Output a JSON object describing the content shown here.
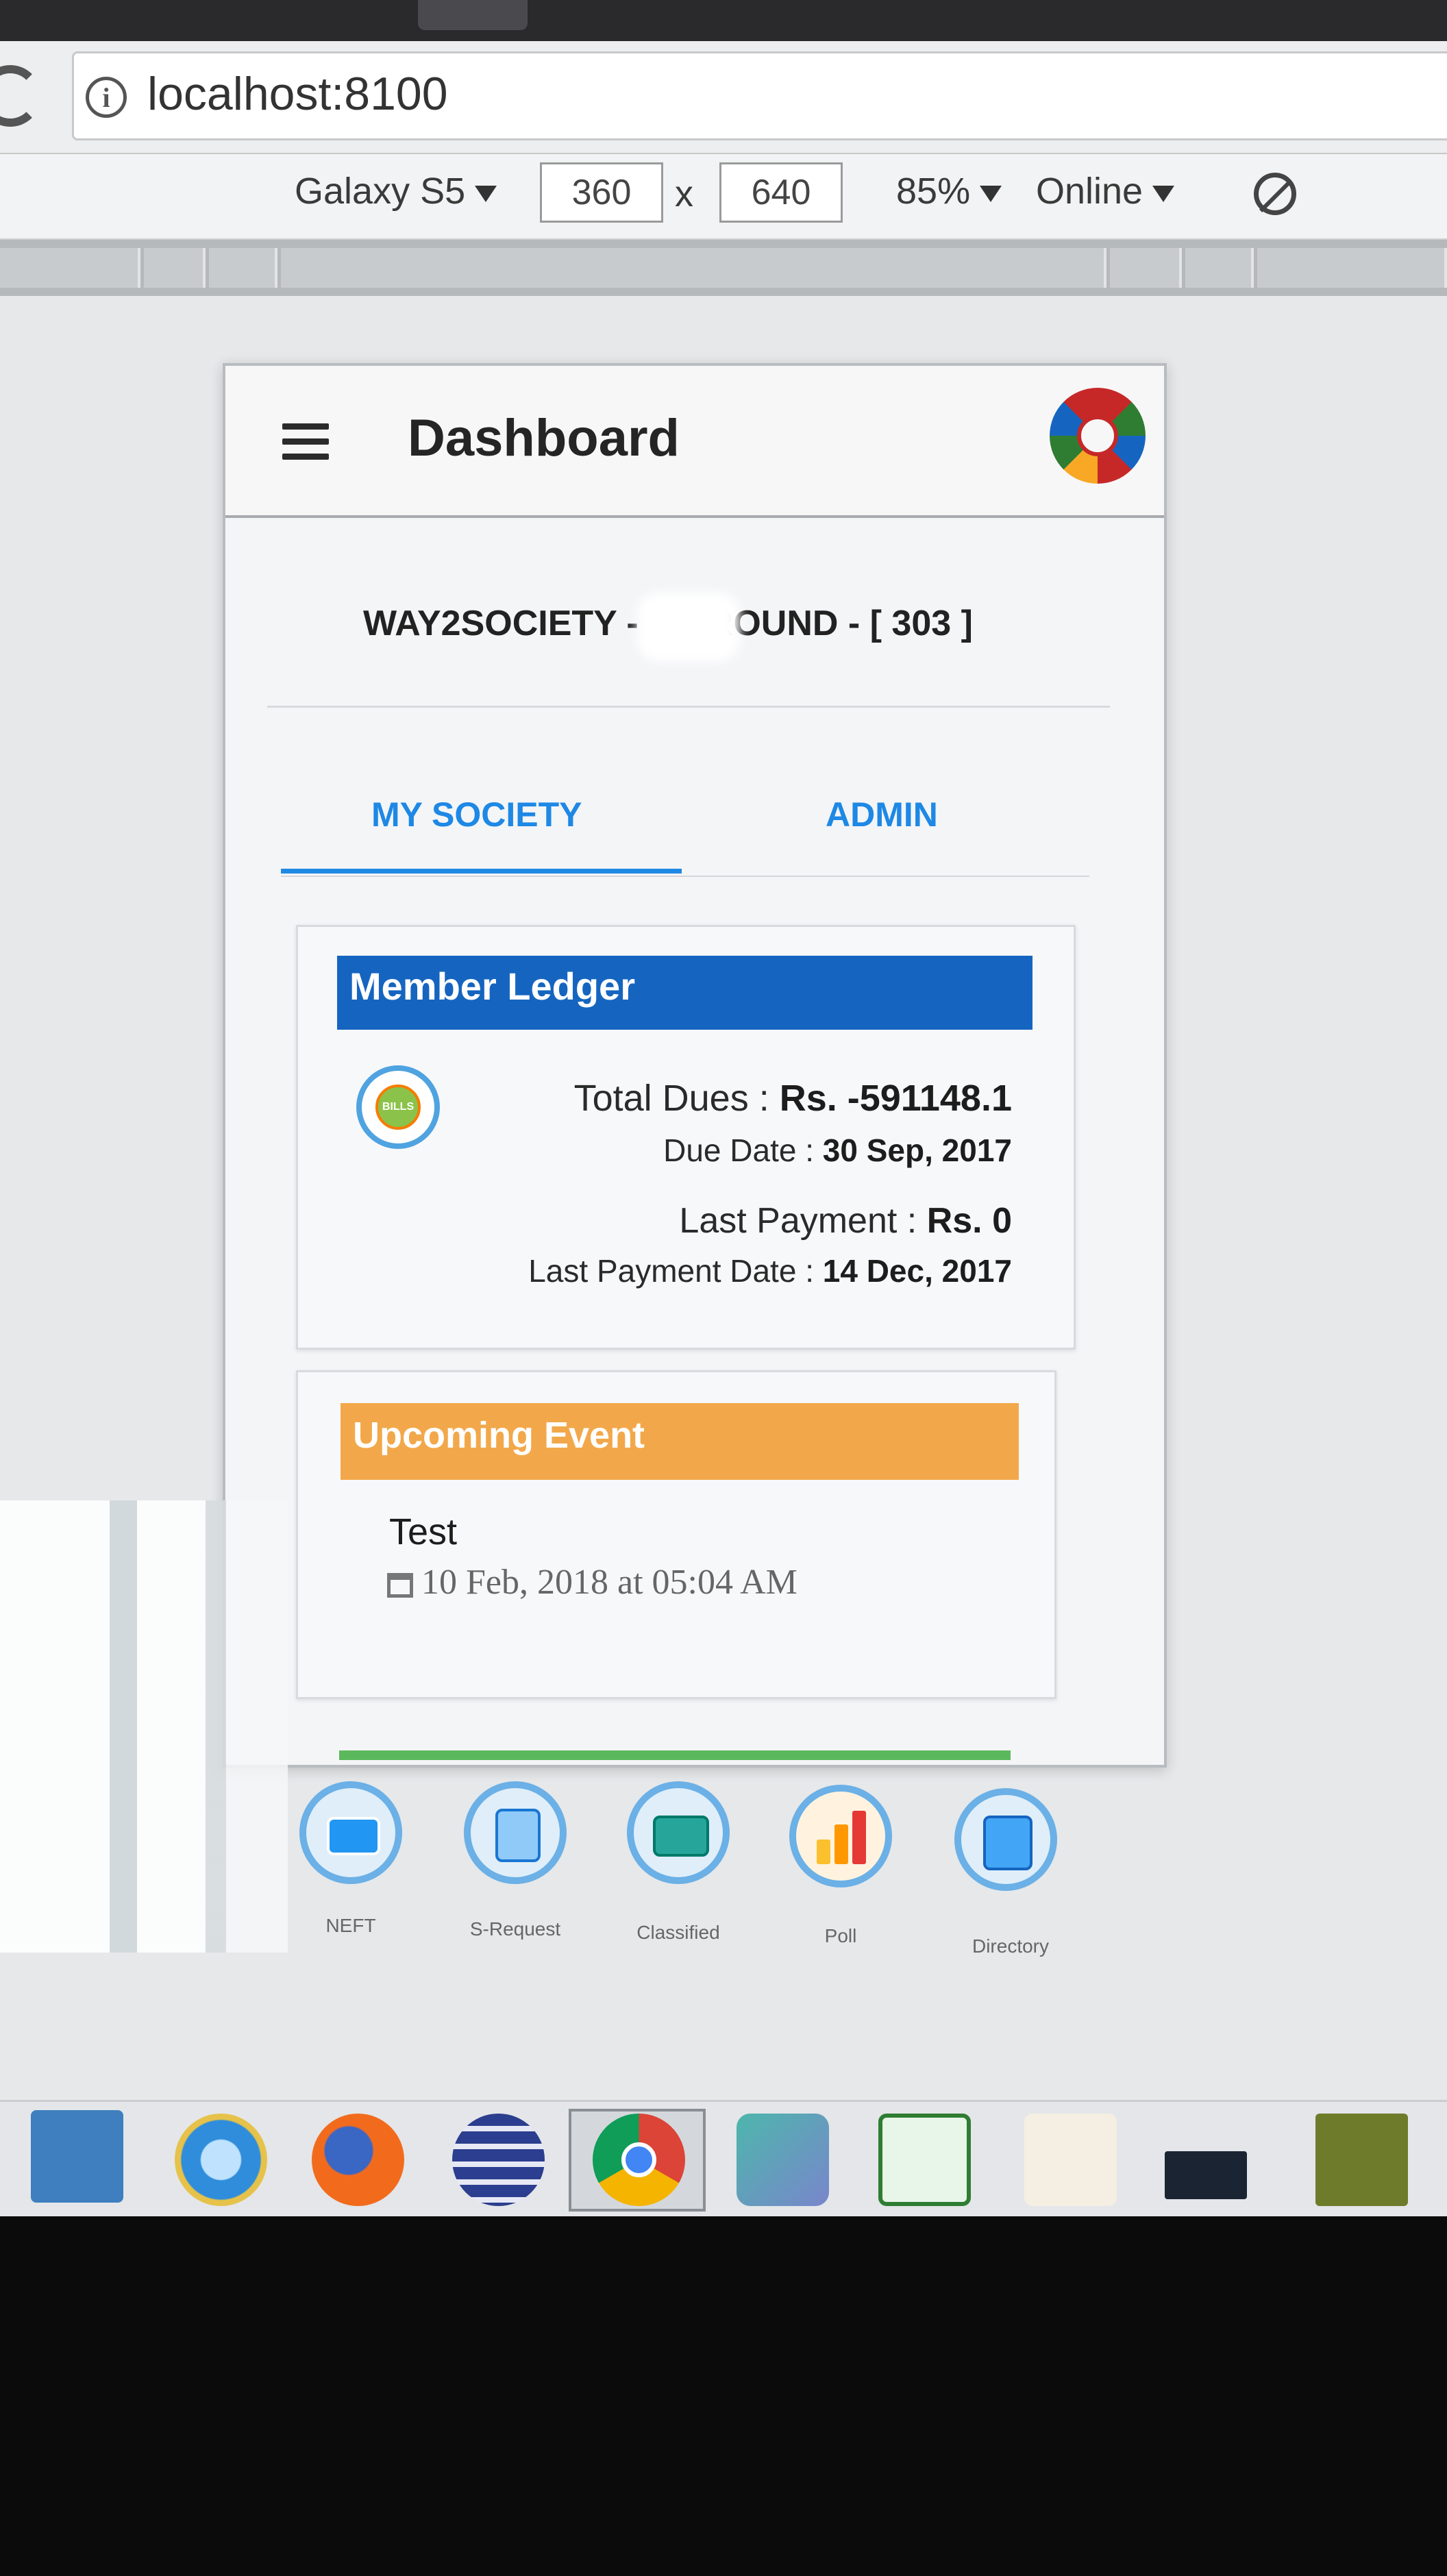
{
  "browser": {
    "url": "localhost:8100",
    "device": "Galaxy S5",
    "width": "360",
    "times": "x",
    "height": "640",
    "zoom": "85%",
    "network": "Online"
  },
  "app": {
    "title": "Dashboard",
    "society_name": "WAY2SOCIETY - F        GROUND - [ 303 ]",
    "tabs": [
      {
        "label": "MY SOCIETY",
        "active": true
      },
      {
        "label": "ADMIN",
        "active": false
      }
    ],
    "ledger": {
      "heading": "Member Ledger",
      "icon_text": "BILLS",
      "total_dues_label": "Total Dues : ",
      "total_dues_value": "Rs. -591148.1",
      "due_date_label": "Due Date : ",
      "due_date_value": "30 Sep, 2017",
      "last_payment_label": "Last Payment : ",
      "last_payment_value": "Rs. 0",
      "last_payment_date_label": "Last Payment Date : ",
      "last_payment_date_value": "14 Dec, 2017"
    },
    "event": {
      "heading": "Upcoming Event",
      "title": "Test",
      "date": "10 Feb, 2018 at 05:04 AM"
    },
    "quick_actions": [
      {
        "label": "NEFT",
        "icon": "card-icon"
      },
      {
        "label": "S-Request",
        "icon": "request-icon"
      },
      {
        "label": "Classified",
        "icon": "classified-icon"
      },
      {
        "label": "Poll",
        "icon": "poll-chart-icon"
      },
      {
        "label": "Directory",
        "icon": "directory-book-icon"
      }
    ]
  },
  "colors": {
    "primary": "#1e88e5",
    "ledger_header": "#1565c0",
    "event_header": "#f2a84a",
    "accent_green": "#5cb85c"
  }
}
